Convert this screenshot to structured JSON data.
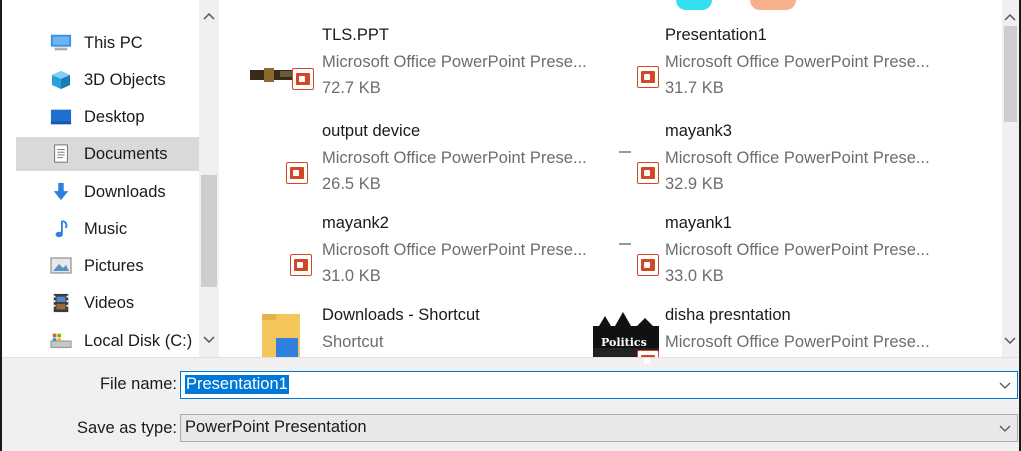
{
  "nav": {
    "items": [
      {
        "label": "This PC",
        "icon": "computer-icon"
      },
      {
        "label": "3D Objects",
        "icon": "cube-icon"
      },
      {
        "label": "Desktop",
        "icon": "desktop-icon"
      },
      {
        "label": "Documents",
        "icon": "documents-icon"
      },
      {
        "label": "Downloads",
        "icon": "download-arrow-icon"
      },
      {
        "label": "Music",
        "icon": "music-note-icon"
      },
      {
        "label": "Pictures",
        "icon": "pictures-icon"
      },
      {
        "label": "Videos",
        "icon": "film-icon"
      },
      {
        "label": "Local Disk (C:)",
        "icon": "disk-icon"
      }
    ],
    "selected": "Documents"
  },
  "files": [
    {
      "name": "TLS.PPT",
      "type": "Microsoft Office PowerPoint Prese...",
      "size": "72.7 KB"
    },
    {
      "name": "Presentation1",
      "type": "Microsoft Office PowerPoint Prese...",
      "size": "31.7 KB"
    },
    {
      "name": "output device",
      "type": "Microsoft Office PowerPoint Prese...",
      "size": "26.5 KB"
    },
    {
      "name": "mayank3",
      "type": "Microsoft Office PowerPoint Prese...",
      "size": "32.9 KB"
    },
    {
      "name": "mayank2",
      "type": "Microsoft Office PowerPoint Prese...",
      "size": "31.0 KB"
    },
    {
      "name": "mayank1",
      "type": "Microsoft Office PowerPoint Prese...",
      "size": "33.0 KB"
    },
    {
      "name": "Downloads - Shortcut",
      "type": "Shortcut",
      "size": ""
    },
    {
      "name": "disha presntation",
      "type": "Microsoft Office PowerPoint Prese...",
      "size": ""
    }
  ],
  "thumb_text": {
    "politics": "Politics"
  },
  "form": {
    "file_name_label": "File name:",
    "file_name_value": "Presentation1",
    "save_type_label": "Save as type:",
    "save_type_value": "PowerPoint Presentation"
  },
  "colors": {
    "accent": "#0078d7",
    "ppt": "#d24726",
    "selected_nav": "#d9d9d9"
  }
}
